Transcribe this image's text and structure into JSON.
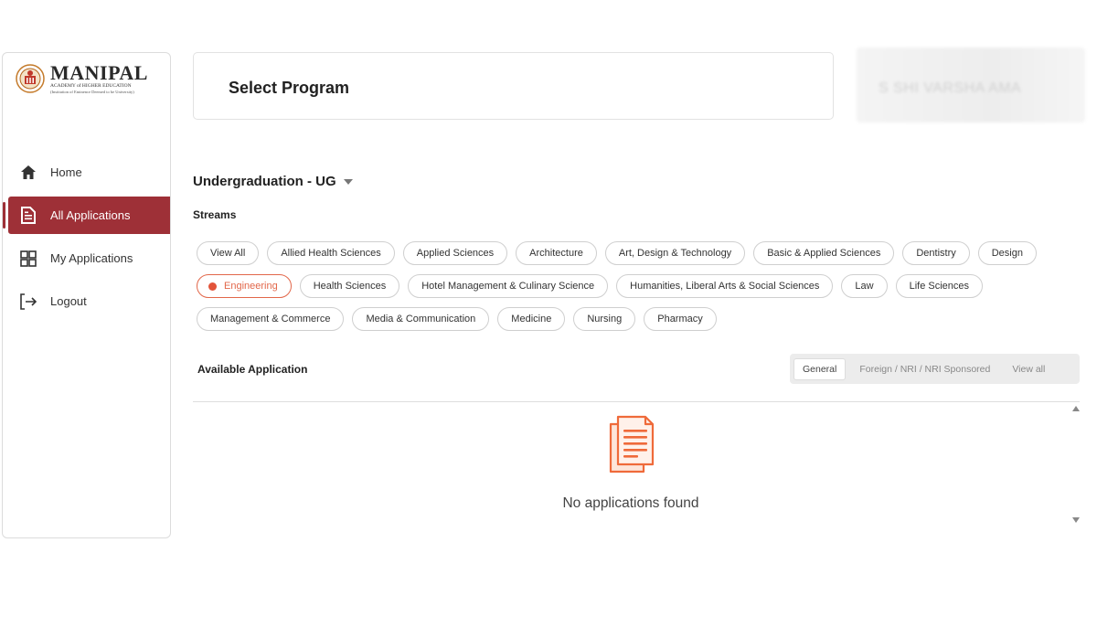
{
  "brand": {
    "title": "MANIPAL",
    "subtitle": "ACADEMY of HIGHER EDUCATION",
    "tagline": "(Institution of Eminence Deemed to be University)"
  },
  "sidebar": {
    "items": [
      {
        "label": "Home",
        "icon": "home-icon"
      },
      {
        "label": "All Applications",
        "icon": "document-icon",
        "active": true
      },
      {
        "label": "My Applications",
        "icon": "grid-icon"
      },
      {
        "label": "Logout",
        "icon": "logout-icon"
      }
    ]
  },
  "header": {
    "title": "Select Program",
    "user_name": "S      SHI VARSHA   AMA"
  },
  "program": {
    "selected": "Undergraduation - UG"
  },
  "streams": {
    "label": "Streams",
    "chips": [
      "View All",
      "Allied Health Sciences",
      "Applied Sciences",
      "Architecture",
      "Art, Design & Technology",
      "Basic & Applied Sciences",
      "Dentistry",
      "Design",
      "Engineering",
      "Health Sciences",
      "Hotel Management & Culinary Science",
      "Humanities, Liberal Arts & Social Sciences",
      "Law",
      "Life Sciences",
      "Management & Commerce",
      "Media & Communication",
      "Medicine",
      "Nursing",
      "Pharmacy"
    ],
    "selected": "Engineering"
  },
  "available": {
    "label": "Available Application",
    "tabs": [
      "General",
      "Foreign / NRI / NRI Sponsored",
      "View all"
    ],
    "active_tab": "General",
    "empty_message": "No applications found"
  },
  "colors": {
    "accent": "#9e3037",
    "highlight": "#e2674a",
    "empty_icon": "#ef6a3a"
  }
}
